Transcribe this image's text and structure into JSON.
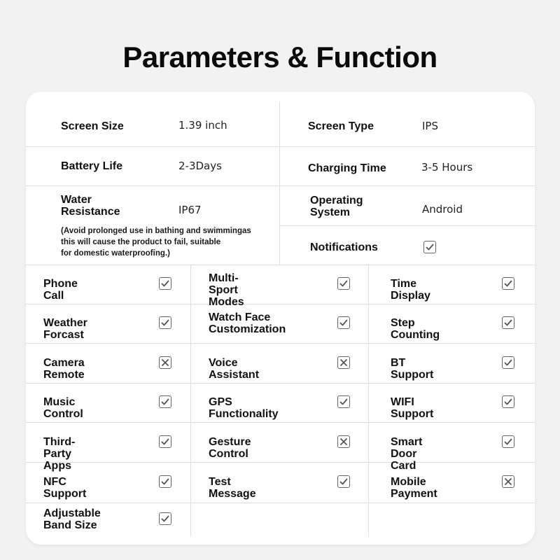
{
  "title": "Parameters & Function",
  "specs": [
    {
      "label": "Screen Size",
      "value": "1.39 inch"
    },
    {
      "label": "Screen Type",
      "value": "IPS"
    },
    {
      "label": "Battery Life",
      "value": "2-3Days"
    },
    {
      "label": "Charging Time",
      "value": "3-5 Hours"
    },
    {
      "label_line1": "Water",
      "label_line2": "Resistance",
      "value": "IP67",
      "note_line1": "(Avoid prolonged use in bathing and swimmingas",
      "note_line2": "this will cause the product to fail, suitable",
      "note_line3": "for domestic waterproofing.)"
    },
    {
      "label_line1": "Operating",
      "label_line2": "System",
      "value": "Android"
    },
    {
      "label": "Notifications",
      "status": "check-icon"
    }
  ],
  "features": [
    {
      "label": "Phone Call",
      "status": "check-icon"
    },
    {
      "label_line1": "Multi-Sport",
      "label_line2": "Modes",
      "status": "check-icon"
    },
    {
      "label": "Time Display",
      "status": "check-icon"
    },
    {
      "label": "Weather Forcast",
      "status": "check-icon"
    },
    {
      "label_line1": "Watch Face",
      "label_line2": "Customization",
      "status": "check-icon"
    },
    {
      "label": "Step Counting",
      "status": "check-icon"
    },
    {
      "label": "Camera Remote",
      "status": "cross-icon"
    },
    {
      "label": "Voice Assistant",
      "status": "cross-icon"
    },
    {
      "label": "BT Support",
      "status": "check-icon"
    },
    {
      "label": "Music Control",
      "status": "check-icon"
    },
    {
      "label": "GPS Functionality",
      "status": "check-icon"
    },
    {
      "label": "WIFI Support",
      "status": "check-icon"
    },
    {
      "label": "Third-Party Apps",
      "status": "check-icon"
    },
    {
      "label": "Gesture Control",
      "status": "cross-icon"
    },
    {
      "label": "Smart Door Card",
      "status": "check-icon"
    },
    {
      "label": "NFC Support",
      "status": "check-icon"
    },
    {
      "label": "Test Message",
      "status": "check-icon"
    },
    {
      "label": "Mobile Payment",
      "status": "cross-icon"
    },
    {
      "label_line1": "Adjustable",
      "label_line2": "Band Size",
      "status": "check-icon"
    }
  ]
}
